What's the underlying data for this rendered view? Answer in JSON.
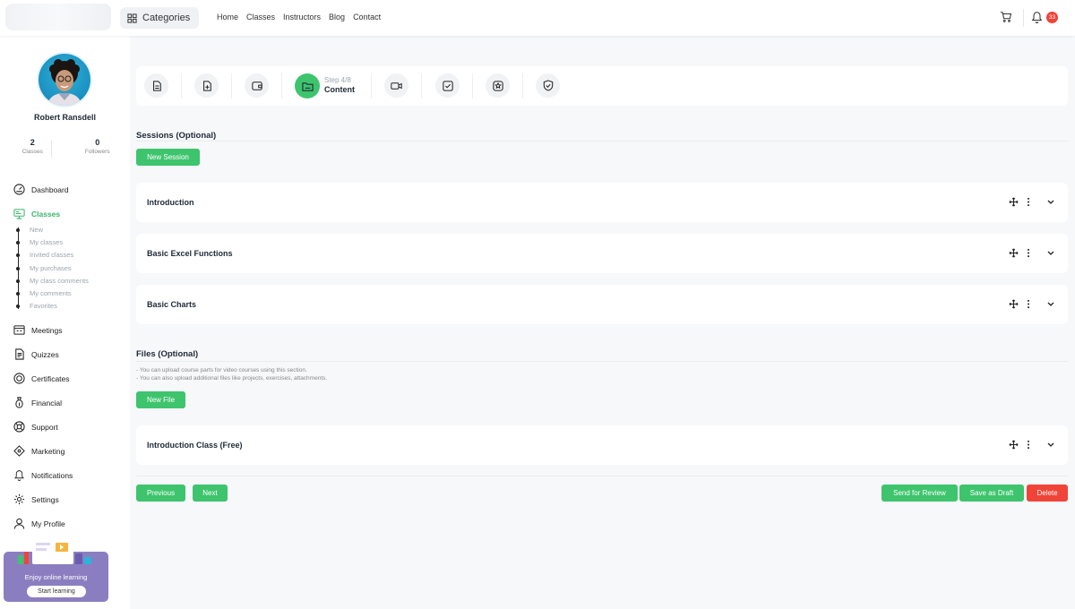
{
  "header": {
    "categories_label": "Categories",
    "nav": [
      "Home",
      "Classes",
      "Instructors",
      "Blog",
      "Contact"
    ],
    "notification_count": "33"
  },
  "profile": {
    "name": "Robert Ransdell",
    "stats": [
      {
        "value": "2",
        "label": "Classes"
      },
      {
        "value": "0",
        "label": "Followers"
      }
    ]
  },
  "sidebar": {
    "items": [
      {
        "label": "Dashboard",
        "icon": "dashboard-icon"
      },
      {
        "label": "Classes",
        "icon": "classes-icon"
      },
      {
        "label": "Meetings",
        "icon": "meetings-icon"
      },
      {
        "label": "Quizzes",
        "icon": "quizzes-icon"
      },
      {
        "label": "Certificates",
        "icon": "certificate-icon"
      },
      {
        "label": "Financial",
        "icon": "financial-icon"
      },
      {
        "label": "Support",
        "icon": "support-icon"
      },
      {
        "label": "Marketing",
        "icon": "marketing-icon"
      },
      {
        "label": "Notifications",
        "icon": "bell-icon"
      },
      {
        "label": "Settings",
        "icon": "gear-icon"
      },
      {
        "label": "My Profile",
        "icon": "user-icon"
      }
    ],
    "classes_sub": [
      "New",
      "My classes",
      "Invited classes",
      "My purchases",
      "My class comments",
      "My comments",
      "Favorites"
    ],
    "promo": {
      "text": "Enjoy online learning",
      "button": "Start learning"
    }
  },
  "stepper": {
    "current_step": "Step 4/8",
    "current_title": "Content",
    "steps": [
      "basic-info-icon",
      "extra-info-icon",
      "pricing-icon",
      "content-icon",
      "video-icon",
      "checklist-icon",
      "quiz-icon",
      "shield-icon"
    ]
  },
  "sessions": {
    "title": "Sessions (Optional)",
    "new_button": "New Session",
    "items": [
      "Introduction",
      "Basic Excel Functions",
      "Basic Charts"
    ]
  },
  "files": {
    "title": "Files (Optional)",
    "notes": [
      "- You can upload course parts for video courses using this section.",
      "- You can also upload additional files like projects, exercises, attachments."
    ],
    "new_button": "New File",
    "items": [
      "Introduction Class (Free)"
    ]
  },
  "footer": {
    "previous": "Previous",
    "next": "Next",
    "send_for_review": "Send for Review",
    "save_as_draft": "Save as Draft",
    "delete": "Delete"
  },
  "colors": {
    "accent": "#3ec46d",
    "danger": "#f04438",
    "promo": "#8b7ec0"
  }
}
